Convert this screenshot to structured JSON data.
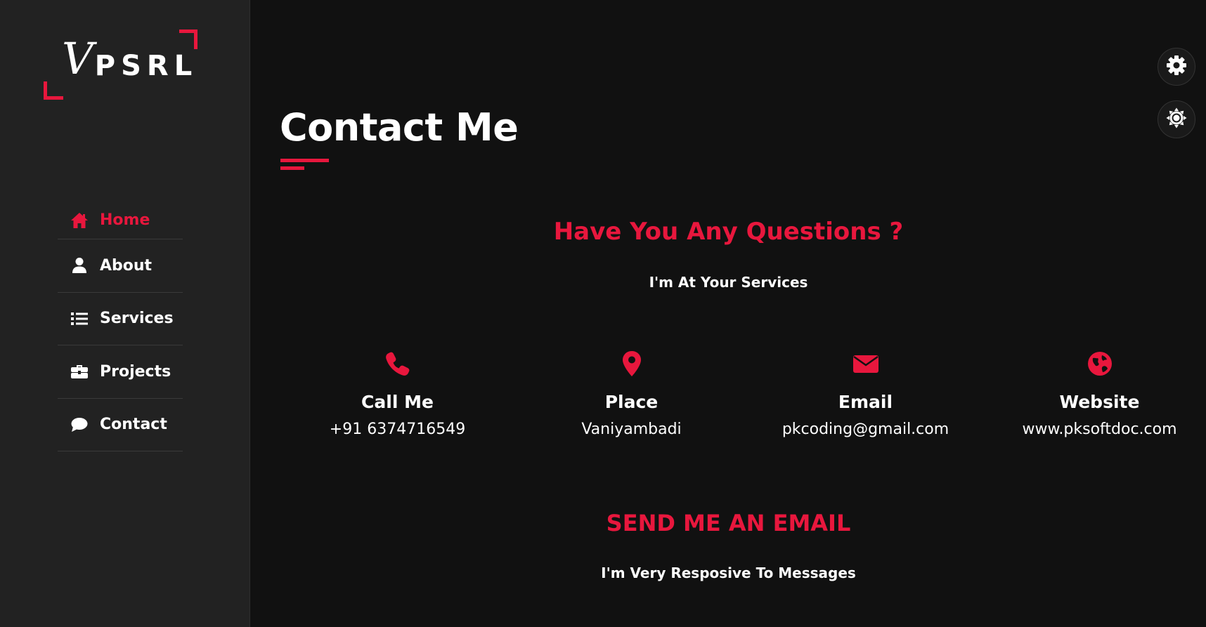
{
  "brand": {
    "logo_text": "PSRL",
    "logo_mark": "V",
    "accent_color": "#e8173d"
  },
  "sidebar": {
    "items": [
      {
        "label": "Home",
        "icon": "home-icon",
        "active": true
      },
      {
        "label": "About",
        "icon": "user-icon",
        "active": false
      },
      {
        "label": "Services",
        "icon": "list-icon",
        "active": false
      },
      {
        "label": "Projects",
        "icon": "briefcase-icon",
        "active": false
      },
      {
        "label": "Contact",
        "icon": "chat-icon",
        "active": false
      }
    ]
  },
  "main": {
    "title": "Contact Me",
    "questions_heading": "Have You Any Questions ?",
    "questions_sub": "I'm At Your Services",
    "contacts": [
      {
        "title": "Call Me",
        "value": "+91 6374716549",
        "icon": "phone-icon"
      },
      {
        "title": "Place",
        "value": "Vaniyambadi",
        "icon": "map-pin-icon"
      },
      {
        "title": "Email",
        "value": "pkcoding@gmail.com",
        "icon": "envelope-icon"
      },
      {
        "title": "Website",
        "value": "www.pksoftdoc.com",
        "icon": "globe-icon"
      }
    ],
    "email_heading": "SEND ME AN EMAIL",
    "email_sub": "I'm Very Resposive To Messages"
  },
  "controls": {
    "settings_icon": "gear-icon",
    "theme_icon": "sun-icon"
  }
}
